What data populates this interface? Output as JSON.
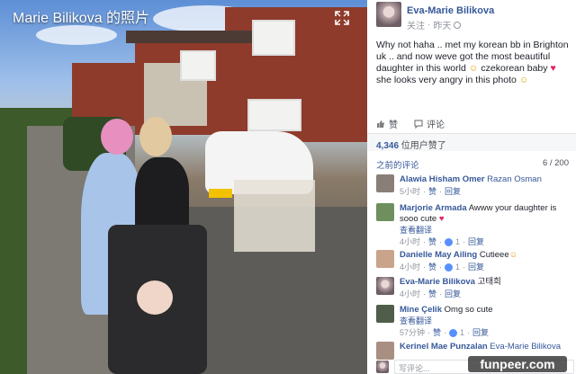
{
  "photo": {
    "title": "Marie Bilikova 的照片"
  },
  "post": {
    "author": "Eva-Marie Bilikova",
    "follow": "关注",
    "dot": "·",
    "time": "昨天",
    "text_line1": "Why not haha .. met my korean bb in Brighton uk .. and now weve got the most beautiful daughter in this world",
    "text_line2": " czekorean baby ",
    "text_line3": " she looks very angry in this photo ",
    "like_label": "赞",
    "comment_label": "评论",
    "likes_count": "4,346",
    "likes_suffix": " 位用户赞了",
    "prev_comments": "之前的评论",
    "comment_count": "6 / 200"
  },
  "comments": [
    {
      "name": "Alawia Hisham Omer",
      "text": " Razan Osman",
      "meta_time": "5小时",
      "meta_like": "赞",
      "meta_reply": "回复",
      "translate": "",
      "reactions": ""
    },
    {
      "name": "Marjorie Armada",
      "text": " Awww your daughter is sooo cute ",
      "meta_time": "4小时",
      "meta_like": "赞",
      "meta_reply": "回复",
      "translate": "查看翻译",
      "reactions": "1"
    },
    {
      "name": "Danielle May Ailing",
      "text": " Cutieee",
      "meta_time": "4小时",
      "meta_like": "赞",
      "meta_reply": "回复",
      "translate": "",
      "reactions": "1"
    },
    {
      "name": "Eva-Marie Bilikova",
      "text": " 고태희",
      "meta_time": "4小时",
      "meta_like": "赞",
      "meta_reply": "回复",
      "translate": "",
      "reactions": ""
    },
    {
      "name": "Mine Çelik",
      "text": " Omg so cute",
      "meta_time": "57分钟",
      "meta_like": "赞",
      "meta_reply": "回复",
      "translate": "查看翻译",
      "reactions": "1"
    },
    {
      "name": "Kerinel Mae Punzalan",
      "text": " Eva-Marie Bilikova",
      "meta_time": "",
      "meta_like": "",
      "meta_reply": "",
      "translate": "",
      "reactions": ""
    }
  ],
  "input": {
    "placeholder": "写评论..."
  },
  "watermark": "funpeer.com",
  "colors": {
    "link": "#365899",
    "meta": "#90949c",
    "like_blue": "#5890ff"
  }
}
